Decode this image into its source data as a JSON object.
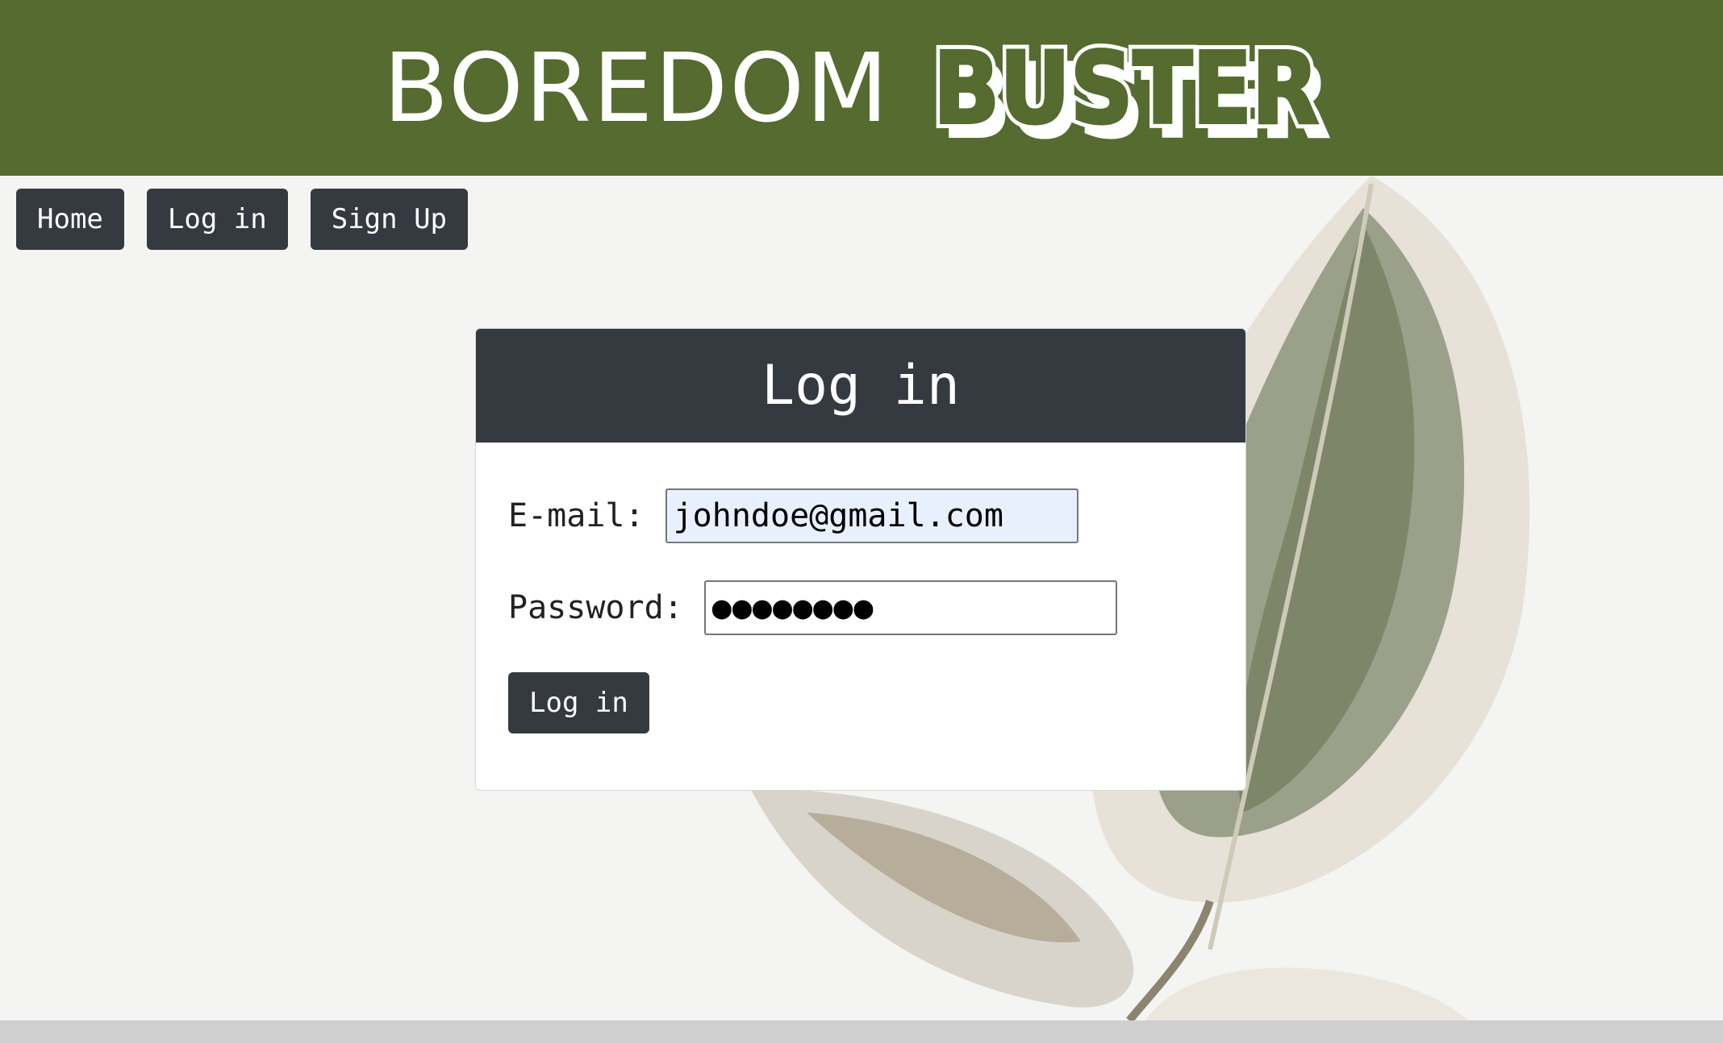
{
  "brand": {
    "word": "BOREDOM",
    "logo_text": "BUSTER",
    "color": "#556b2f"
  },
  "nav": {
    "home": "Home",
    "login": "Log in",
    "signup": "Sign Up"
  },
  "login_card": {
    "title": "Log in",
    "email_label": "E-mail:",
    "email_value": "johndoe@gmail.com",
    "password_label": "Password:",
    "password_value": "●●●●●●●●",
    "submit_label": "Log in"
  },
  "colors": {
    "header": "#556b2f",
    "button": "#343a40",
    "autofill": "#e8f0fe"
  }
}
